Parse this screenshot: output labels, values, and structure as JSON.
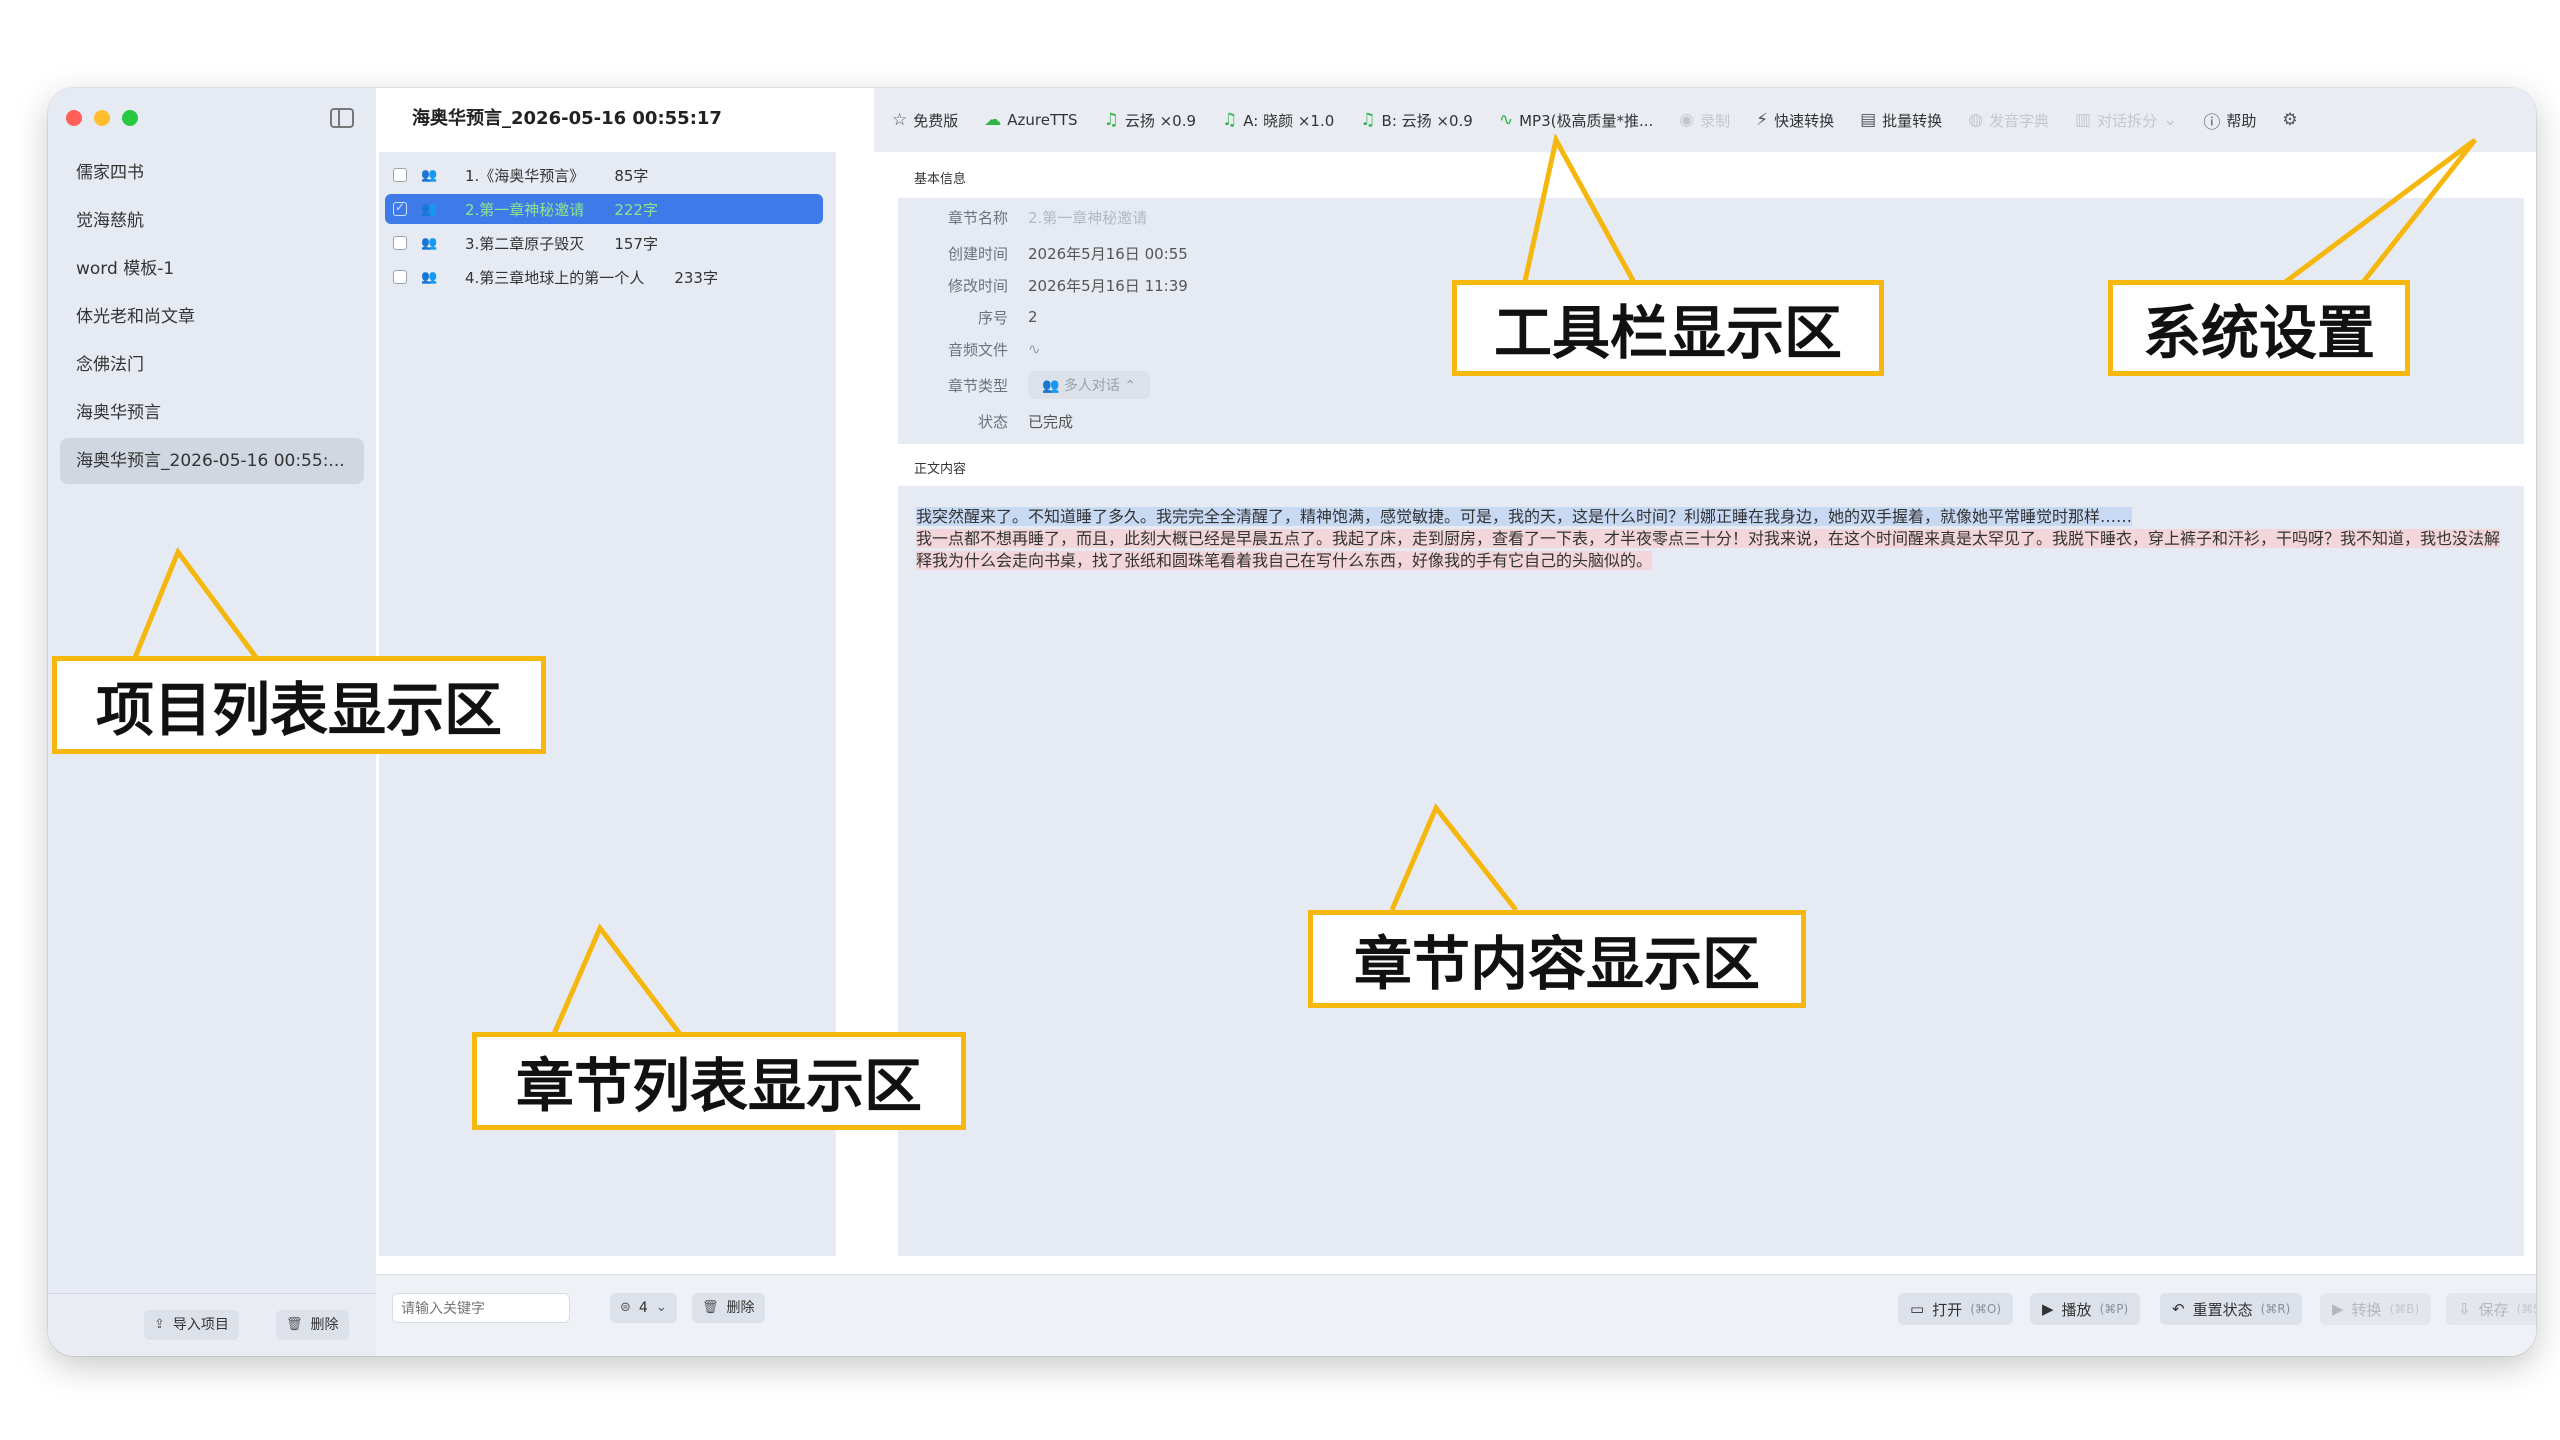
{
  "sidebar": {
    "projects": [
      "儒家四书",
      "觉海慈航",
      "word 模板-1",
      "体光老和尚文章",
      "念佛法门",
      "海奥华预言",
      "海奥华预言_2026-05-16 00:55:..."
    ],
    "import_label": "导入项目",
    "delete_label": "删除"
  },
  "header": {
    "title": "海奥华预言_2026-05-16 00:55:17"
  },
  "chapters": {
    "items": [
      {
        "title": "1.《海奥华预言》",
        "count": "85字"
      },
      {
        "title": "2.第一章神秘邀请",
        "count": "222字"
      },
      {
        "title": "3.第二章原子毁灭",
        "count": "157字"
      },
      {
        "title": "4.第三章地球上的第一个人",
        "count": "233字"
      }
    ],
    "search_placeholder": "请输入关键字",
    "filter_value": "4",
    "delete_label": "删除"
  },
  "toolbar": {
    "free_label": "免费版",
    "engine_label": "AzureTTS",
    "voice_label": "云扬 ×0.9",
    "voice_a_label": "A: 晓颜 ×1.0",
    "voice_b_label": "B: 云扬 ×0.9",
    "format_label": "MP3(极高质量*推...",
    "record_label": "录制",
    "quick_convert_label": "快速转换",
    "batch_convert_label": "批量转换",
    "dictionary_label": "发音字典",
    "dialog_split_label": "对话拆分",
    "help_label": "帮助"
  },
  "info": {
    "section_label": "基本信息",
    "name_label": "章节名称",
    "name_value": "2.第一章神秘邀请",
    "created_label": "创建时间",
    "created_value": "2026年5月16日 00:55",
    "modified_label": "修改时间",
    "modified_value": "2026年5月16日 11:39",
    "index_label": "序号",
    "index_value": "2",
    "audio_label": "音频文件",
    "type_label": "章节类型",
    "type_value": "多人对话",
    "status_label": "状态",
    "status_value": "已完成"
  },
  "body": {
    "section_label": "正文内容",
    "text_a": "我突然醒来了。不知道睡了多久。我完完全全清醒了，精神饱满，感觉敏捷。可是，我的天，这是什么时间？利娜正睡在我身边，她的双手握着，就像她平常睡觉时那样……",
    "text_b": "我一点都不想再睡了，而且，此刻大概已经是早晨五点了。我起了床，走到厨房，查看了一下表，才半夜零点三十分！对我来说，在这个时间醒来真是太罕见了。我脱下睡衣，穿上裤子和汗衫，干吗呀？我不知道，我也没法解释我为什么会走向书桌，找了张纸和圆珠笔看着我自己在写什么东西，好像我的手有它自己的头脑似的。"
  },
  "actions": {
    "open_label": "打开",
    "open_sc": "(⌘O)",
    "play_label": "播放",
    "play_sc": "(⌘P)",
    "reset_label": "重置状态",
    "reset_sc": "(⌘R)",
    "convert_label": "转换",
    "convert_sc": "(⌘B)",
    "save_label": "保存",
    "save_sc": "(⌘S)"
  },
  "callouts": {
    "toolbar": "工具栏显示区",
    "settings": "系统设置",
    "projects": "项目列表显示区",
    "chapters": "章节列表显示区",
    "content": "章节内容显示区"
  },
  "colors": {
    "callout_border": "#f5b70e",
    "selected_row": "#3e7be8",
    "panel_bg": "#e6ebf3"
  }
}
